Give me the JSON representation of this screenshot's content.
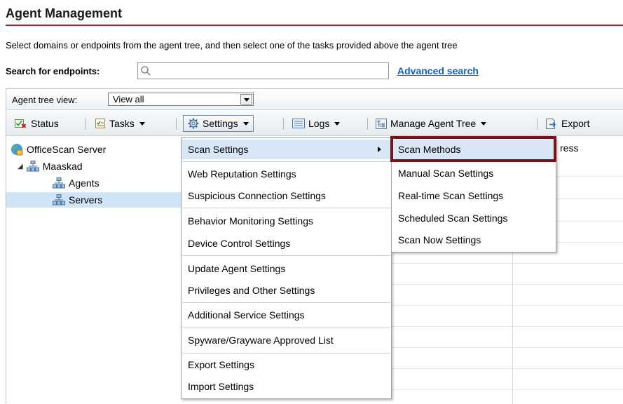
{
  "page": {
    "title": "Agent Management",
    "instructions": "Select domains or endpoints from the agent tree, and then select one of the tasks provided above the agent tree"
  },
  "search": {
    "label": "Search for endpoints:",
    "value": "",
    "advanced_link": "Advanced search"
  },
  "view": {
    "label": "Agent tree view:",
    "selected": "View all"
  },
  "toolbar": {
    "status": "Status",
    "tasks": "Tasks",
    "settings": "Settings",
    "logs": "Logs",
    "manage": "Manage Agent Tree",
    "export": "Export"
  },
  "tree": {
    "root": "OfficeScan Server",
    "domain": "Maaskad",
    "children": [
      "Agents",
      "Servers"
    ],
    "selected": "Servers"
  },
  "grid": {
    "partial_header": "ress"
  },
  "settings_menu": {
    "items": [
      "Scan Settings",
      "Web Reputation Settings",
      "Suspicious Connection Settings",
      "Behavior Monitoring Settings",
      "Device Control Settings",
      "Update Agent Settings",
      "Privileges and Other Settings",
      "Additional Service Settings",
      "Spyware/Grayware Approved List",
      "Export Settings",
      "Import Settings"
    ]
  },
  "scan_submenu": {
    "items": [
      "Scan Methods",
      "Manual Scan Settings",
      "Real-time Scan Settings",
      "Scheduled Scan Settings",
      "Scan Now Settings"
    ],
    "highlighted": "Scan Methods"
  },
  "colors": {
    "title_rule": "#c8102e",
    "link": "#0b5ed7",
    "selection": "#cfe5f7",
    "menu_hover": "#d8e7f5",
    "highlight_border": "#7a1019"
  }
}
